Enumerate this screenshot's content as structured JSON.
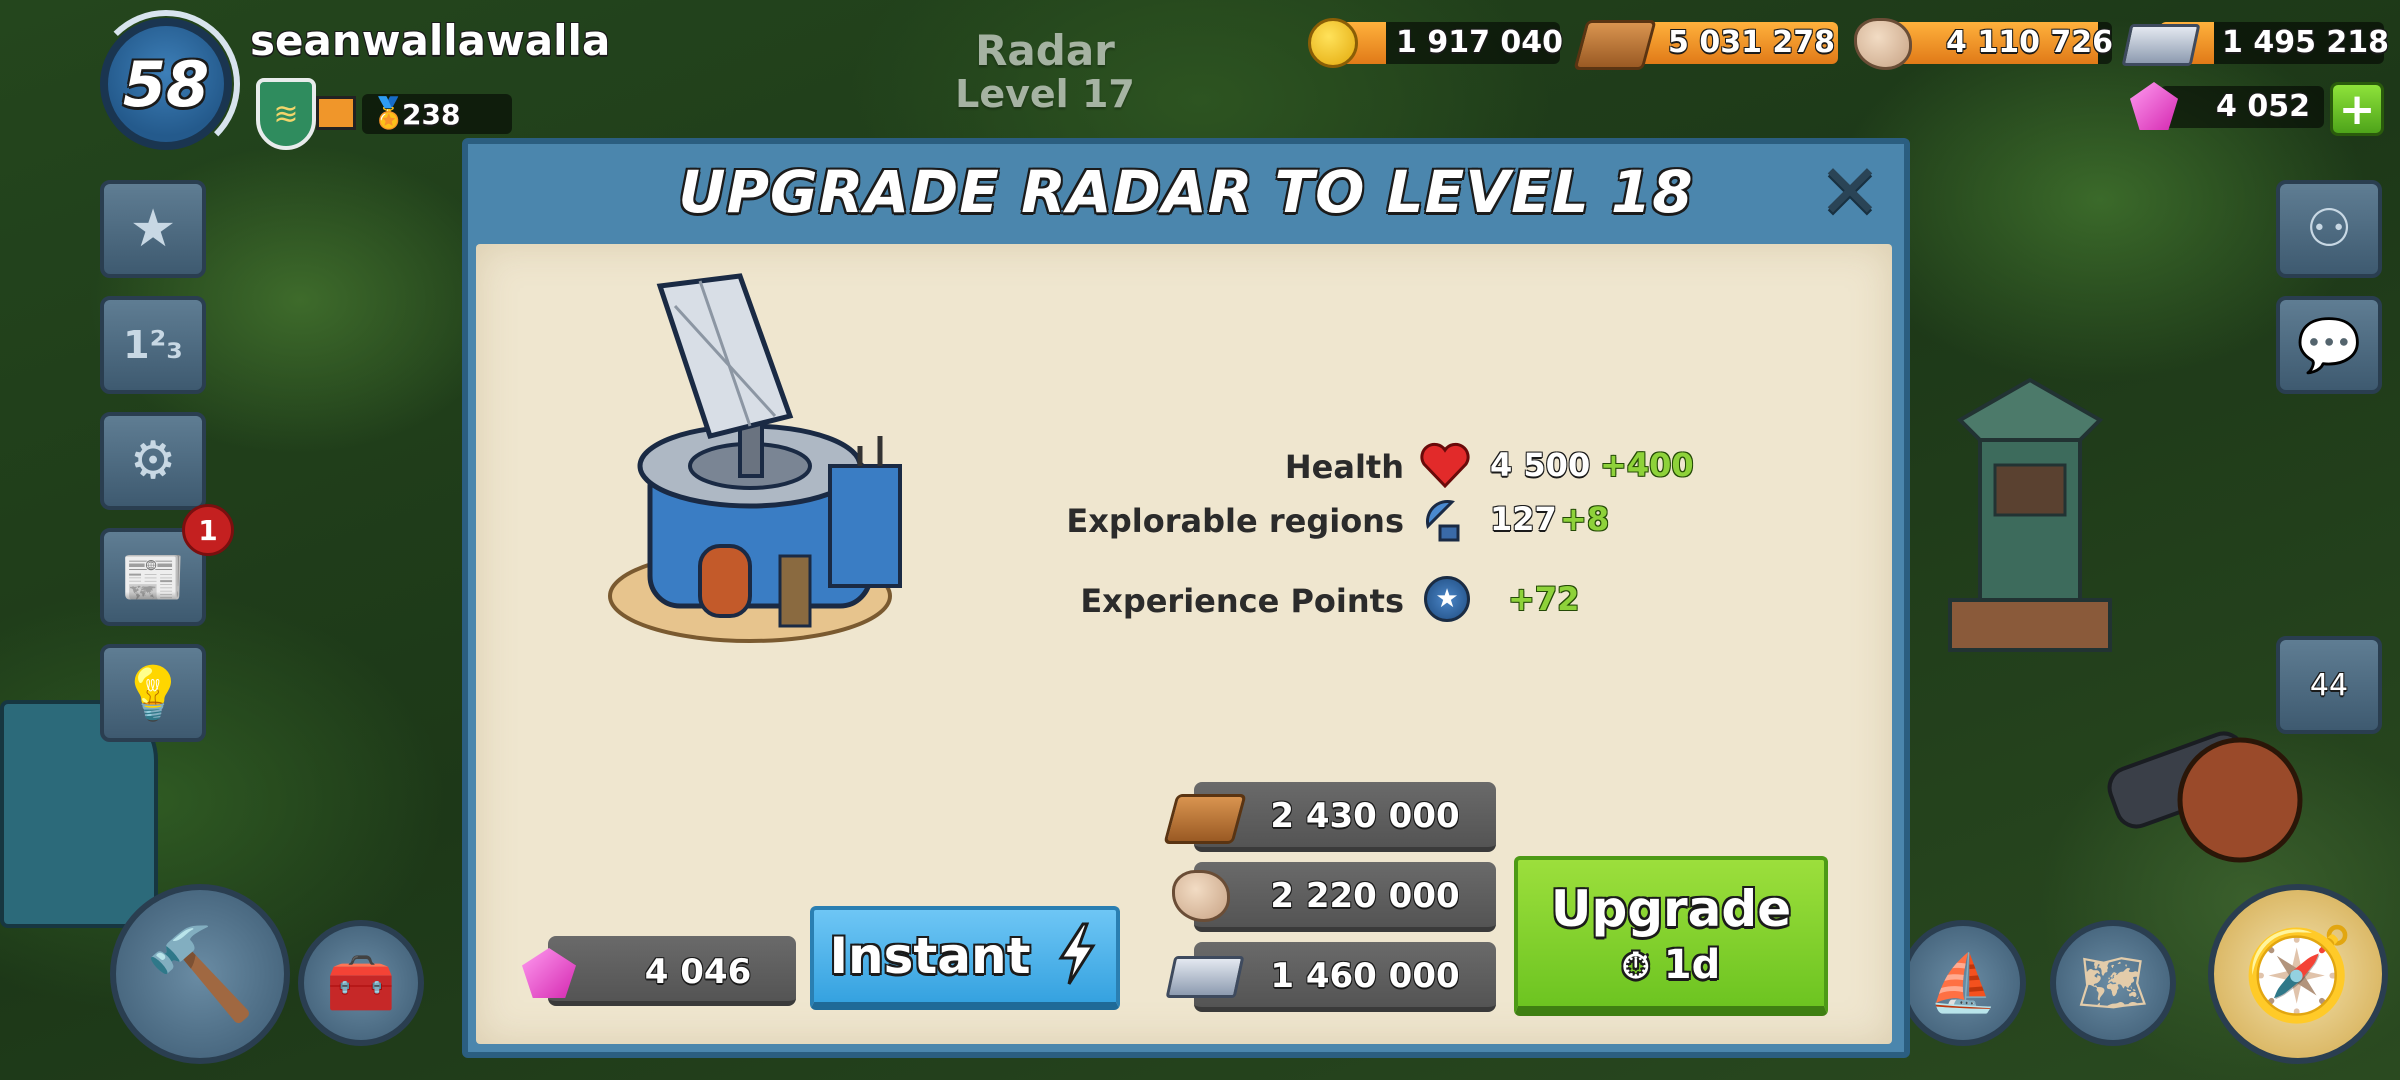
{
  "player": {
    "level": "58",
    "name": "seanwallawalla",
    "medals": "238"
  },
  "background_building": {
    "name": "Radar",
    "level": "Level 17"
  },
  "resources": {
    "gold": "1 917 040",
    "wood": "5 031 278",
    "stone": "4 110 726",
    "iron": "1 495 218",
    "diamonds": "4 052"
  },
  "sidebar": {
    "notification_count": "1",
    "troops_count": "44"
  },
  "dialog": {
    "title": "UPGRADE RADAR TO LEVEL 18",
    "stats": [
      {
        "label": "Health",
        "icon": "heart-icon",
        "value": "4 500",
        "bonus": "+400"
      },
      {
        "label": "Explorable regions",
        "icon": "radar-dish-icon",
        "value": "127",
        "bonus": "+8"
      },
      {
        "label": "Experience Points",
        "icon": "experience-star-icon",
        "value": "",
        "bonus": "+72"
      }
    ],
    "costs": {
      "wood": "2 430 000",
      "stone": "2 220 000",
      "iron": "1 460 000"
    },
    "instant": {
      "gem_cost": "4 046",
      "label": "Instant"
    },
    "upgrade": {
      "label": "Upgrade",
      "time": "1d"
    }
  },
  "colors": {
    "dialog_blue": "#4b86ad",
    "paper": "#efe6cf",
    "upgrade_green": "#7fd12c",
    "instant_blue": "#4bb0ea",
    "resource_orange": "#f09a2a"
  }
}
